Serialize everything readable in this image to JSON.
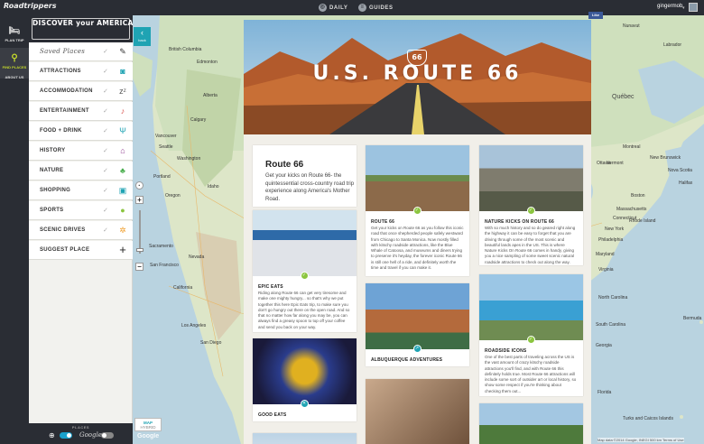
{
  "topbar": {
    "logo": "Roadtrippers",
    "nav": [
      {
        "label": "DAILY",
        "icon": "compass-icon"
      },
      {
        "label": "GUIDES",
        "icon": "guides-icon"
      }
    ],
    "username": "gingermob",
    "fb_like": "Like"
  },
  "rail": {
    "items": [
      {
        "label": "PLAN TRIP",
        "icon": "bed-icon",
        "active": false
      },
      {
        "label": "FIND PLACES",
        "icon": "map-pin-icon",
        "active": true
      },
      {
        "label": "ABOUT US",
        "icon": "",
        "active": false
      }
    ]
  },
  "sidebar": {
    "banner_main": "DISCOVER your AMERICA",
    "banner_sub": "America",
    "categories": [
      {
        "label": "Saved Places",
        "icon": "pin-icon",
        "color": "#333333"
      },
      {
        "label": "ATTRACTIONS",
        "icon": "camera-icon",
        "color": "#1fa3b3"
      },
      {
        "label": "ACCOMMODATION",
        "icon": "sleep-icon",
        "color": "#555555"
      },
      {
        "label": "ENTERTAINMENT",
        "icon": "guitar-icon",
        "color": "#d9534f"
      },
      {
        "label": "FOOD + DRINK",
        "icon": "cutlery-icon",
        "color": "#1fa3b3"
      },
      {
        "label": "HISTORY",
        "icon": "building-icon",
        "color": "#8e3c8e"
      },
      {
        "label": "NATURE",
        "icon": "leaf-icon",
        "color": "#4caf50"
      },
      {
        "label": "SHOPPING",
        "icon": "bag-icon",
        "color": "#1fa3b3"
      },
      {
        "label": "SPORTS",
        "icon": "ball-icon",
        "color": "#8bc53f"
      },
      {
        "label": "SCENIC DRIVES",
        "icon": "wheel-icon",
        "color": "#f0a030"
      },
      {
        "label": "SUGGEST PLACE",
        "icon": "plus-icon",
        "color": "#222222"
      }
    ],
    "places_label": "PLACES",
    "google_label": "Google"
  },
  "map": {
    "back_label": "back",
    "toggle_map": "MAP",
    "toggle_hybrid": "HYBRID",
    "google_logo": "Google",
    "copyright": "Map data ©2014 Google, INEGI  500 km  Terms of Use",
    "labels": [
      {
        "text": "British Columbia",
        "pos": "bc"
      },
      {
        "text": "Alberta",
        "pos": "ab"
      },
      {
        "text": "Edmonton",
        "pos": "edm"
      },
      {
        "text": "Calgary",
        "pos": "cal"
      },
      {
        "text": "Vancouver",
        "pos": "van"
      },
      {
        "text": "Seattle",
        "pos": "sea"
      },
      {
        "text": "Portland",
        "pos": "por"
      },
      {
        "text": "Washington",
        "pos": "wa"
      },
      {
        "text": "Oregon",
        "pos": "or"
      },
      {
        "text": "Idaho",
        "pos": "id"
      },
      {
        "text": "Nevada",
        "pos": "nv"
      },
      {
        "text": "Sacramento",
        "pos": "sac"
      },
      {
        "text": "San Francisco",
        "pos": "sf"
      },
      {
        "text": "California",
        "pos": "ca"
      },
      {
        "text": "Los Angeles",
        "pos": "la"
      },
      {
        "text": "San Diego",
        "pos": "sd"
      },
      {
        "text": "Québec",
        "pos": "qc"
      },
      {
        "text": "Labrador",
        "pos": "lab"
      },
      {
        "text": "New Brunswick",
        "pos": "nb"
      },
      {
        "text": "Nova Scotia",
        "pos": "ns"
      },
      {
        "text": "Vermont",
        "pos": "vt"
      },
      {
        "text": "Boston",
        "pos": "bos"
      },
      {
        "text": "Massachusetts",
        "pos": "ma"
      },
      {
        "text": "Connecticut",
        "pos": "ct"
      },
      {
        "text": "Rhode Island",
        "pos": "ri"
      },
      {
        "text": "New York",
        "pos": "ny"
      },
      {
        "text": "Philadelphia",
        "pos": "phi"
      },
      {
        "text": "Maryland",
        "pos": "md"
      },
      {
        "text": "Virginia",
        "pos": "va"
      },
      {
        "text": "North Carolina",
        "pos": "nc"
      },
      {
        "text": "South Carolina",
        "pos": "sc"
      },
      {
        "text": "Georgia",
        "pos": "ga"
      },
      {
        "text": "Florida",
        "pos": "fl"
      },
      {
        "text": "Bermuda",
        "pos": "ber"
      },
      {
        "text": "Turks and Caicos Islands",
        "pos": "tci"
      },
      {
        "text": "Ottawa",
        "pos": "ott"
      },
      {
        "text": "Montreal",
        "pos": "mtl"
      },
      {
        "text": "Halifax",
        "pos": "hfx"
      },
      {
        "text": "Nunavut",
        "pos": "nu"
      }
    ]
  },
  "guide": {
    "hero_title": "U.S. ROUTE 66",
    "hero_shield": "66",
    "intro_title": "Route 66",
    "intro_text": "Get your kicks on Route 66- the quintessential cross-country road trip experience along America's Mother Road.",
    "cards": [
      {
        "id": "route66",
        "title": "ROUTE 66",
        "desc": "Get your kicks on Route 66 as you follow this iconic road that once shepherded people safely westward from Chicago to Santa Monica. Now mostly filled with kitschy roadside attractions, like the Blue Whale of Catoosa, and museums and diners trying to preserve it's heyday, the forever iconic Route 66 is still one hell of a ride, and definitely worth the time and travel if you can make it."
      },
      {
        "id": "nature",
        "title": "NATURE KICKS ON ROUTE 66",
        "desc": "With so much history and so do geared right along the highway it can be easy to forget that you are driving through some of the most scenic and beautiful lands apes in the US. This is where Nature Kicks On Route 66 comes in handy, giving you a nice sampling of some sweet scenic natural roadside attractions to check out along the way."
      },
      {
        "id": "epic",
        "title": "EPIC EATS",
        "desc": "Riding along Route 66 can get very tiresome and make one mighty hungry... so that's why we put together this here Epic Eats trip, to make sure you don't go hungry out there on the open road. And so that no matter how far along you may be, you can always find a greasy spoon to top off your coffee and send you back on your way."
      },
      {
        "id": "albuquerque",
        "title": "ALBUQUERQUE ADVENTURES",
        "desc": ""
      },
      {
        "id": "roadside",
        "title": "ROADSIDE ICONS",
        "desc": "One of the best parts of traveling across the US is the vast amount of crazy kitschy roadside attractions you'll find, and with Route 66 this definitely holds true. Most Route 66 attractions will include some sort of outsider art or local history, so show some respect if you're thinking about checking them out..."
      },
      {
        "id": "goodeats",
        "title": "GOOD EATS",
        "desc": ""
      }
    ]
  },
  "colors": {
    "accent": "#1fa3b3",
    "highlight": "#c3d82c",
    "dark": "#2a2d34",
    "badge_green": "#8bc53f"
  }
}
